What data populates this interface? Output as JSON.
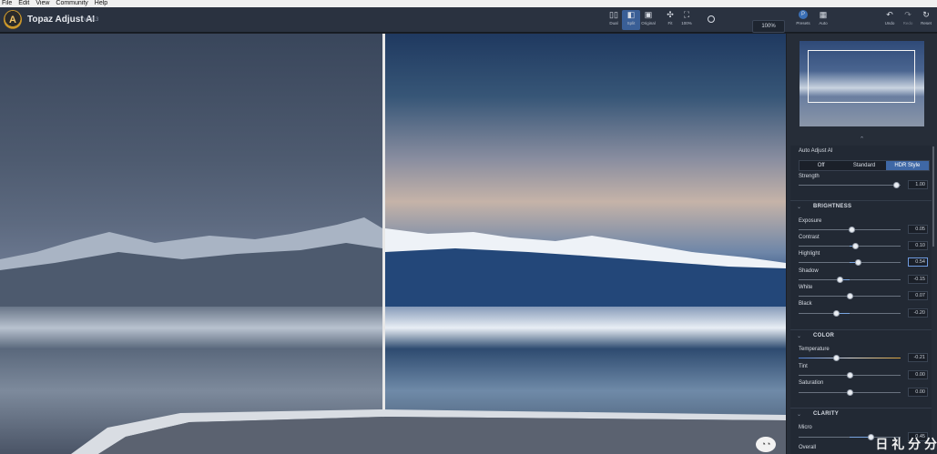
{
  "menu": [
    "File",
    "Edit",
    "View",
    "Community",
    "Help"
  ],
  "app": {
    "title": "Topaz Adjust AI",
    "version": "v1.0.3",
    "logo_letter": "A"
  },
  "toolbar": {
    "views": [
      {
        "label": "Dual",
        "icon": "dual-view-icon",
        "glyph": "▯▯"
      },
      {
        "label": "Split",
        "icon": "split-view-icon",
        "glyph": "◧"
      },
      {
        "label": "Original",
        "icon": "original-view-icon",
        "glyph": "▣"
      },
      {
        "label": "Fit",
        "icon": "fit-icon",
        "glyph": "✣"
      },
      {
        "label": "100%",
        "icon": "actual-size-icon",
        "glyph": "⛶"
      }
    ],
    "zoom": "100%",
    "presets_label": "Presets",
    "auto_label": "Auto",
    "undo_label": "Undo",
    "redo_label": "Redo",
    "reset_label": "Reset"
  },
  "panel": {
    "auto_title": "Auto Adjust AI",
    "modes": [
      "Off",
      "Standard",
      "HDR Style"
    ],
    "active_mode": "HDR Style",
    "strength_label": "Strength",
    "strength": "1.00",
    "sections": {
      "brightness": "BRIGHTNESS",
      "color": "COLOR",
      "clarity": "CLARITY"
    },
    "brightness": [
      {
        "label": "Exposure",
        "value": "0.05"
      },
      {
        "label": "Contrast",
        "value": "0.10"
      },
      {
        "label": "Highlight",
        "value": "0.54"
      },
      {
        "label": "Shadow",
        "value": "-0.15"
      },
      {
        "label": "White",
        "value": "0.07"
      },
      {
        "label": "Black",
        "value": "-0.20"
      }
    ],
    "color": [
      {
        "label": "Temperature",
        "value": "-0.21"
      },
      {
        "label": "Tint",
        "value": "0.00"
      },
      {
        "label": "Saturation",
        "value": "0.00"
      }
    ],
    "clarity": [
      {
        "label": "Micro",
        "value": "0.45"
      },
      {
        "label": "Overall",
        "value": ""
      }
    ]
  },
  "watermark": "日 礼 分 分"
}
